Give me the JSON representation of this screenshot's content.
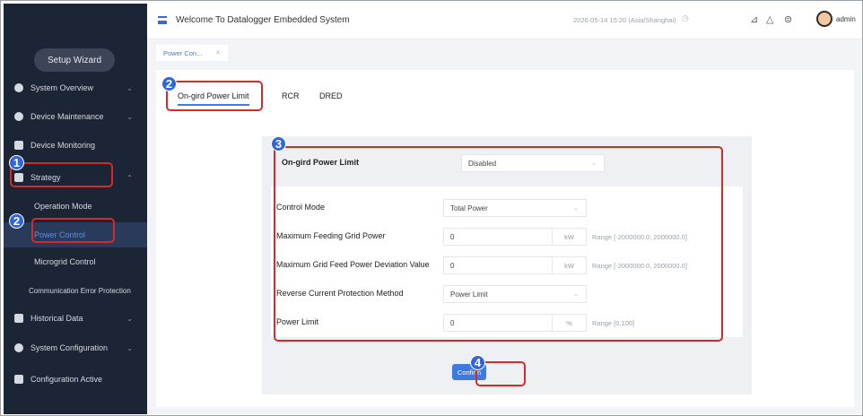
{
  "header": {
    "title": "Welcome To Datalogger Embedded System",
    "datetime": "2026-05-14 15:20 (Asia/Shanghai)",
    "user": "admin"
  },
  "sidebar": {
    "wizard": "Setup Wizard",
    "items": [
      {
        "label": "System Overview"
      },
      {
        "label": "Device Maintenance"
      },
      {
        "label": "Device Monitoring"
      },
      {
        "label": "Strategy"
      },
      {
        "label": "Historical Data"
      },
      {
        "label": "System Configuration"
      },
      {
        "label": "Configuration Active"
      }
    ],
    "sub_items": [
      {
        "label": "Operation Mode"
      },
      {
        "label": "Power Control"
      },
      {
        "label": "Microgrid Control"
      },
      {
        "label": "Communication Error Protection"
      }
    ]
  },
  "tabs": {
    "open_tab": "Power Con..."
  },
  "subtabs": [
    "On-gird Power Limit",
    "RCR",
    "DRED"
  ],
  "form": {
    "limit_label": "On-gird Power Limit",
    "limit_value": "Disabled",
    "control_mode_label": "Control Mode",
    "control_mode_value": "Total Power",
    "max_feed_label": "Maximum Feeding Grid Power",
    "max_feed_value": "0",
    "max_feed_unit": "kW",
    "max_feed_range": "Range [-2000000.0, 2000000.0]",
    "max_dev_label": "Maximum Grid Feed Power Deviation Value",
    "max_dev_value": "0",
    "max_dev_unit": "kW",
    "max_dev_range": "Range [-2000000.0, 2000000.0]",
    "reverse_label": "Reverse Current Protection Method",
    "reverse_value": "Power Limit",
    "power_limit_label": "Power Limit",
    "power_limit_value": "0",
    "power_limit_unit": "%",
    "power_limit_range": "Range [0,100]",
    "confirm_label": "Confirm"
  },
  "badges": [
    "1",
    "2",
    "2",
    "3",
    "4"
  ],
  "colors": {
    "annotation": "#d62a2a",
    "badge": "#2f67d8",
    "accent": "#3d7be0",
    "sidebar": "#1c2536"
  }
}
